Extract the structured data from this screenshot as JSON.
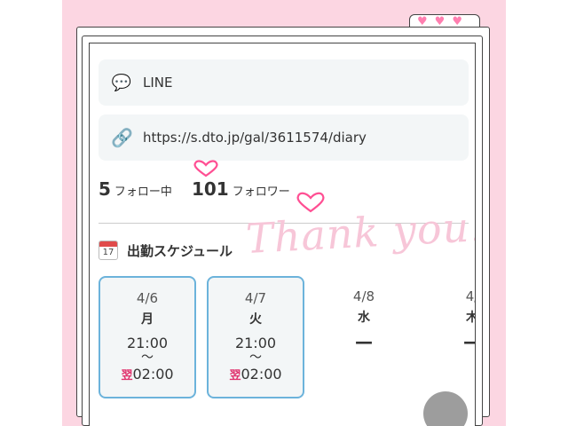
{
  "links": [
    {
      "icon": "speech-bubble-icon",
      "label": "LINE"
    },
    {
      "icon": "chain-link-icon",
      "label": "https://s.dto.jp/gal/3611574/diary"
    }
  ],
  "follow": {
    "following_count": "5",
    "following_label": "フォロー中",
    "followers_count": "101",
    "followers_label": "フォロワー"
  },
  "decoration": {
    "script_text": "Thank you.",
    "hearts": "❤❤❤"
  },
  "schedule": {
    "title": "出勤スケジュール",
    "calendar_icon_number": "17",
    "days": [
      {
        "date": "4/6",
        "dow": "月",
        "start": "21:00",
        "tilde": "〜",
        "next_day_mark": "翌",
        "end": "02:00",
        "active": true
      },
      {
        "date": "4/7",
        "dow": "火",
        "start": "21:00",
        "tilde": "〜",
        "next_day_mark": "翌",
        "end": "02:00",
        "active": true
      },
      {
        "date": "4/8",
        "dow": "水",
        "status": "—",
        "active": false
      },
      {
        "date": "4/",
        "dow": "木",
        "status": "—",
        "active": false
      }
    ]
  },
  "colors": {
    "accent_pink": "#fcd6e2",
    "active_border": "#6cb3db",
    "next_day": "#e0336e"
  }
}
